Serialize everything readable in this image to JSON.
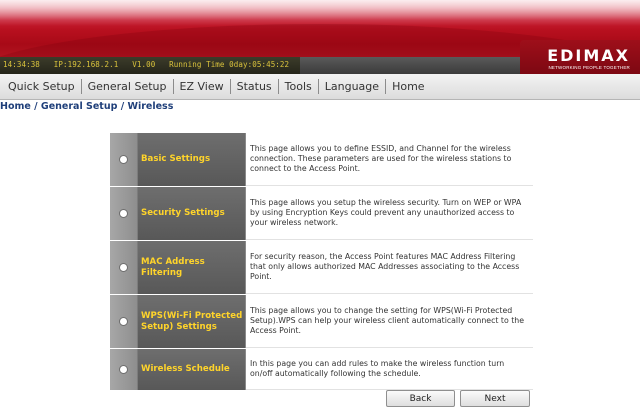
{
  "status": {
    "text": "14:34:38   IP:192.168.2.1   V1.00   Running Time 0day:05:45:22"
  },
  "brand": {
    "name": "EDIMAX",
    "tagline": "NETWORKING PEOPLE TOGETHER"
  },
  "nav": {
    "items": [
      {
        "label": "Quick Setup"
      },
      {
        "label": "General Setup"
      },
      {
        "label": "EZ View"
      },
      {
        "label": "Status"
      },
      {
        "label": "Tools"
      },
      {
        "label": "Language"
      },
      {
        "label": "Home"
      }
    ]
  },
  "breadcrumb": "Home / General Setup / Wireless",
  "options": [
    {
      "title": "Basic Settings",
      "description": "This page allows you to define ESSID, and Channel for the wireless connection. These parameters are used for the wireless stations to connect to the Access Point."
    },
    {
      "title": "Security Settings",
      "description": "This page allows you setup the wireless security. Turn on WEP or WPA by using Encryption Keys could prevent any unauthorized access to your wireless network."
    },
    {
      "title": "MAC Address Filtering",
      "description": "For security reason, the Access Point features MAC Address Filtering that only allows authorized MAC Addresses associating to the Access Point."
    },
    {
      "title": "WPS(Wi-Fi Protected Setup) Settings",
      "description": "This page allows you to change the setting for WPS(Wi-Fi Protected Setup).WPS can help your wireless client automatically connect to the Access Point."
    },
    {
      "title": "Wireless Schedule",
      "description": "In this page you can add rules to make the wireless function turn on/off automatically following the schedule."
    }
  ],
  "buttons": {
    "back": "Back",
    "next": "Next"
  }
}
